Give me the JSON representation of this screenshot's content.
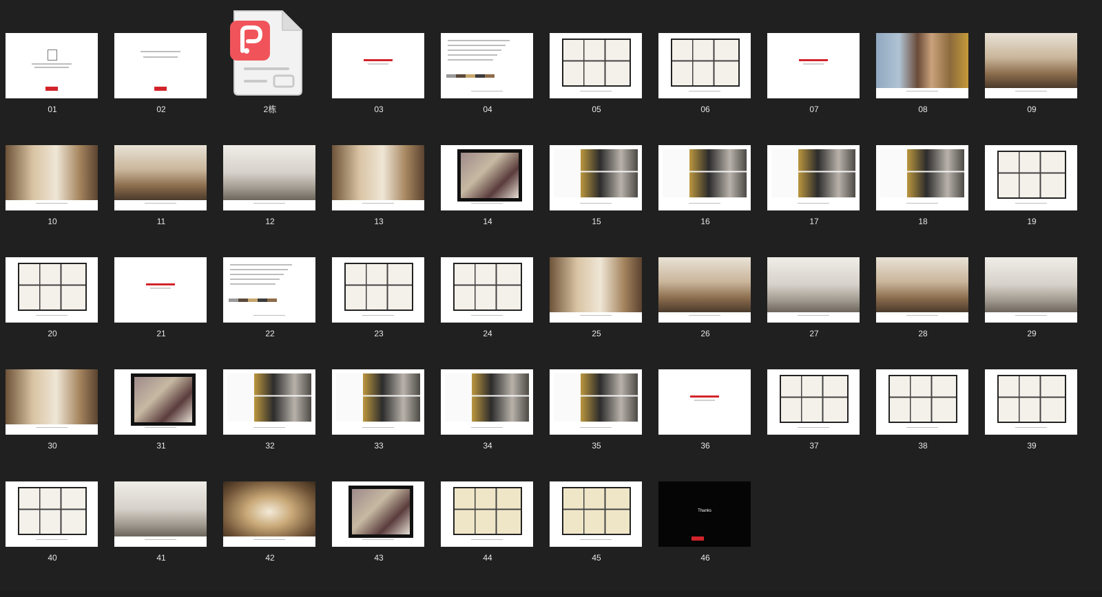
{
  "items": [
    {
      "label": "01",
      "kind": "cover"
    },
    {
      "label": "02",
      "kind": "title"
    },
    {
      "label": "2栋",
      "kind": "pdf-file",
      "icon": "pdf-document-icon"
    },
    {
      "label": "03",
      "kind": "section-red"
    },
    {
      "label": "04",
      "kind": "text-strip"
    },
    {
      "label": "05",
      "kind": "plan"
    },
    {
      "label": "06",
      "kind": "plan"
    },
    {
      "label": "07",
      "kind": "section-red"
    },
    {
      "label": "08",
      "kind": "photo-fashion"
    },
    {
      "label": "09",
      "kind": "photo-interior"
    },
    {
      "label": "10",
      "kind": "photo-warm"
    },
    {
      "label": "11",
      "kind": "photo-interior"
    },
    {
      "label": "12",
      "kind": "photo-gray"
    },
    {
      "label": "13",
      "kind": "photo-warm"
    },
    {
      "label": "14",
      "kind": "board"
    },
    {
      "label": "15",
      "kind": "collage"
    },
    {
      "label": "16",
      "kind": "collage"
    },
    {
      "label": "17",
      "kind": "collage"
    },
    {
      "label": "18",
      "kind": "collage"
    },
    {
      "label": "19",
      "kind": "plan"
    },
    {
      "label": "20",
      "kind": "plan"
    },
    {
      "label": "21",
      "kind": "section-red"
    },
    {
      "label": "22",
      "kind": "text-strip"
    },
    {
      "label": "23",
      "kind": "plan"
    },
    {
      "label": "24",
      "kind": "plan"
    },
    {
      "label": "25",
      "kind": "photo-warm"
    },
    {
      "label": "26",
      "kind": "photo-interior"
    },
    {
      "label": "27",
      "kind": "photo-gray"
    },
    {
      "label": "28",
      "kind": "photo-interior"
    },
    {
      "label": "29",
      "kind": "photo-gray"
    },
    {
      "label": "30",
      "kind": "photo-warm"
    },
    {
      "label": "31",
      "kind": "board"
    },
    {
      "label": "32",
      "kind": "collage"
    },
    {
      "label": "33",
      "kind": "collage"
    },
    {
      "label": "34",
      "kind": "collage"
    },
    {
      "label": "35",
      "kind": "collage"
    },
    {
      "label": "36",
      "kind": "section-red"
    },
    {
      "label": "37",
      "kind": "plan"
    },
    {
      "label": "38",
      "kind": "plan"
    },
    {
      "label": "39",
      "kind": "plan"
    },
    {
      "label": "40",
      "kind": "plan"
    },
    {
      "label": "41",
      "kind": "photo-gray"
    },
    {
      "label": "42",
      "kind": "photo-corridor"
    },
    {
      "label": "43",
      "kind": "board"
    },
    {
      "label": "44",
      "kind": "plan-beige"
    },
    {
      "label": "45",
      "kind": "plan-beige"
    },
    {
      "label": "46",
      "kind": "thanks",
      "text": "Thanks"
    }
  ],
  "colors": {
    "background": "#202020",
    "caption": "#e6e6e6",
    "accent_red": "#d2232a",
    "pdf_red": "#f0545a"
  }
}
